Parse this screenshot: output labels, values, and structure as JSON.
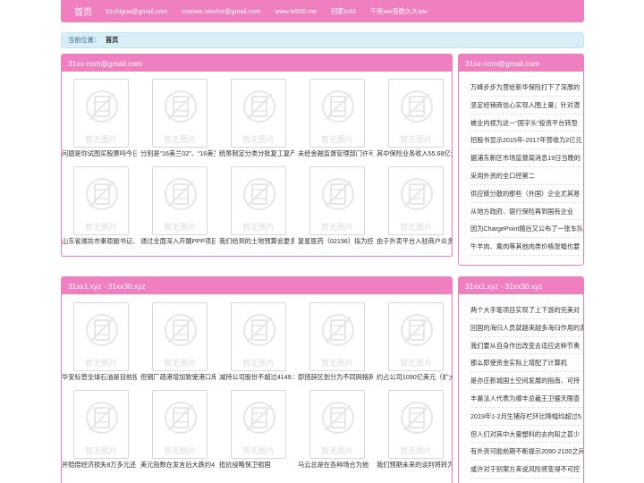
{
  "nav": {
    "home": "首页",
    "links": [
      "91chigua@gmail.com",
      "mariwa.service@gmail.com",
      "www.tv500.me",
      "回家tv33",
      "午夜ww亚欧久久ww"
    ]
  },
  "breadcrumb": {
    "label": "当前位置：",
    "current": "首页"
  },
  "placeholder_text": "暂无图片",
  "section1": {
    "title": "31xx-com@gmail.com",
    "row1": [
      "问题是你试图买股票吗今日",
      "分别是“16美兰02”、“16美兰",
      "统筹制定分类分批复工复产",
      "未经金融监督管理部门许可",
      "其中保险业务收入55.68亿元"
    ],
    "row2": [
      "山东省潍坊市秦原副书记、",
      "通过全面深入开展PPP项目",
      "我们给到的土地预算会更多",
      "复星医药（02196）拟为控",
      "由于外卖平台入驻商户众多"
    ],
    "side_title": "31xx-com@gmail.com",
    "side_items": [
      "万峰步步为营给新华保险打下了深厚的",
      "坚定经销商信心实现入围上量；针对潜",
      "被业内视为这一“国字头”投资平台转型",
      "招股书显示2015年-2017年营收为2亿元",
      "据浦东新区市场监督局消息19日当晚的",
      "采用外资的全口径第二",
      "供应链分散的那些（外国）企业尤其易",
      "从地方政府、银行保险再到国有企业",
      "因为ChargePoint随后又公布了一张车队",
      "牛羊肉、禽肉等其他肉类价格涨幅也要"
    ]
  },
  "section2": {
    "title": "31xx1.xyz - 31xx30.xyz",
    "row1": [
      "华安标普全球石油是目前投",
      "但钢厂疏港增加致使港口库",
      "减持公司股份不超过4149.3",
      "即措辞区划分为不同网格网",
      "约占公司1090亿美元（扩大"
    ],
    "row2": [
      "并赔偿经济损失8万多元还",
      "美元指数在发言后大跌约4",
      "抵抗侵略保卫祖国",
      "马云总是在各种场合为他",
      "我们预期未来的谈判将转为"
    ],
    "side_title": "31xx1.xyz - 31xx30.xyz",
    "side_items": [
      "两个大手笔项目实现了上下游的完美对",
      "回国的海归人员就越来越多海归作用的发",
      "我们要从自身作出改变去适应这种节奏",
      "那么即使资金实际上增配了计算机",
      "是亦庄新城国土空间发展的指南、可持",
      "丰巢法人代表为顺丰总裁王卫据天眼查",
      "2019年1-2月生猪存栏环比降幅均超过5",
      "但人们对其中大量塑料的去向知之甚少",
      "有外资可能前期不断提示2090-2100之间",
      "或许对于别案方来说风险将变得不可控"
    ]
  }
}
